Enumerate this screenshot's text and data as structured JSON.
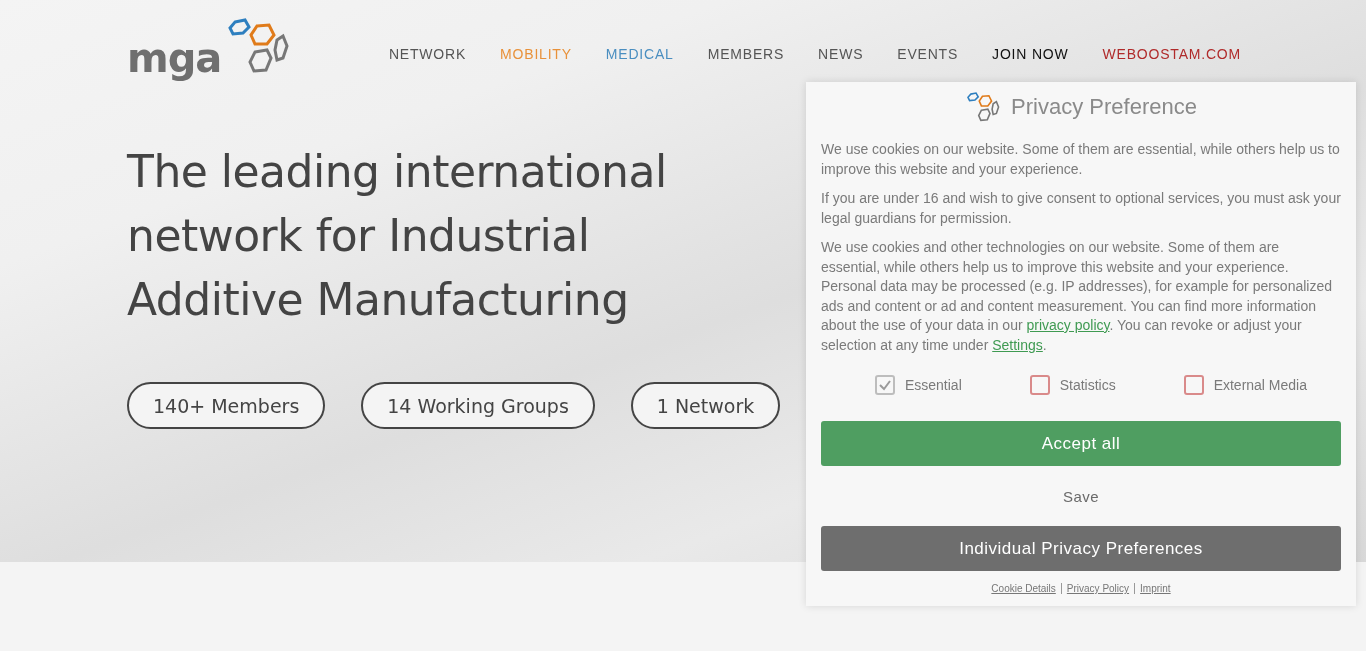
{
  "header": {
    "logo_text": "mga",
    "nav": [
      {
        "label": "NETWORK",
        "color": "#555555"
      },
      {
        "label": "MOBILITY",
        "color": "#e8913a"
      },
      {
        "label": "MEDICAL",
        "color": "#4a8ec0"
      },
      {
        "label": "MEMBERS",
        "color": "#555555"
      },
      {
        "label": "NEWS",
        "color": "#555555"
      },
      {
        "label": "EVENTS",
        "color": "#555555"
      },
      {
        "label": "JOIN NOW",
        "color": "#111111"
      },
      {
        "label": "WEBOOSTAM.COM",
        "color": "#b02a2a"
      }
    ]
  },
  "hero": {
    "headline": "The leading international network for Industrial Additive Manufacturing",
    "stats": [
      "140+ Members",
      "14 Working Groups",
      "1 Network"
    ]
  },
  "privacy_dialog": {
    "title": "Privacy Preference",
    "paragraphs": [
      [
        {
          "kind": "text",
          "text": "We use cookies on our website. Some of them are essential, while others help us to improve this website and your experience."
        }
      ],
      [
        {
          "kind": "text",
          "text": "If you are under 16 and wish to give consent to optional services, you must ask your legal guardians for permission."
        }
      ],
      [
        {
          "kind": "text",
          "text": "We use cookies and other technologies on our website. Some of them are essential, while others help us to improve this website and your experience. Personal data may be processed (e.g. IP addresses), for example for personalized ads and content or ad and content measurement. You can find more information about the use of your data in our "
        },
        {
          "kind": "link",
          "text": "privacy policy"
        },
        {
          "kind": "text",
          "text": ". You can revoke or adjust your selection at any time under "
        },
        {
          "kind": "link",
          "text": "Settings"
        },
        {
          "kind": "text",
          "text": "."
        }
      ]
    ],
    "options": [
      {
        "label": "Essential",
        "checked": true
      },
      {
        "label": "Statistics",
        "checked": false
      },
      {
        "label": "External Media",
        "checked": false
      }
    ],
    "buttons": [
      {
        "kind": "primary",
        "label": "Accept all"
      },
      {
        "kind": "plain",
        "label": "Save"
      },
      {
        "kind": "secondary",
        "label": "Individual Privacy Preferences"
      }
    ],
    "footer_links": [
      "Cookie Details",
      "Privacy Policy",
      "Imprint"
    ]
  }
}
